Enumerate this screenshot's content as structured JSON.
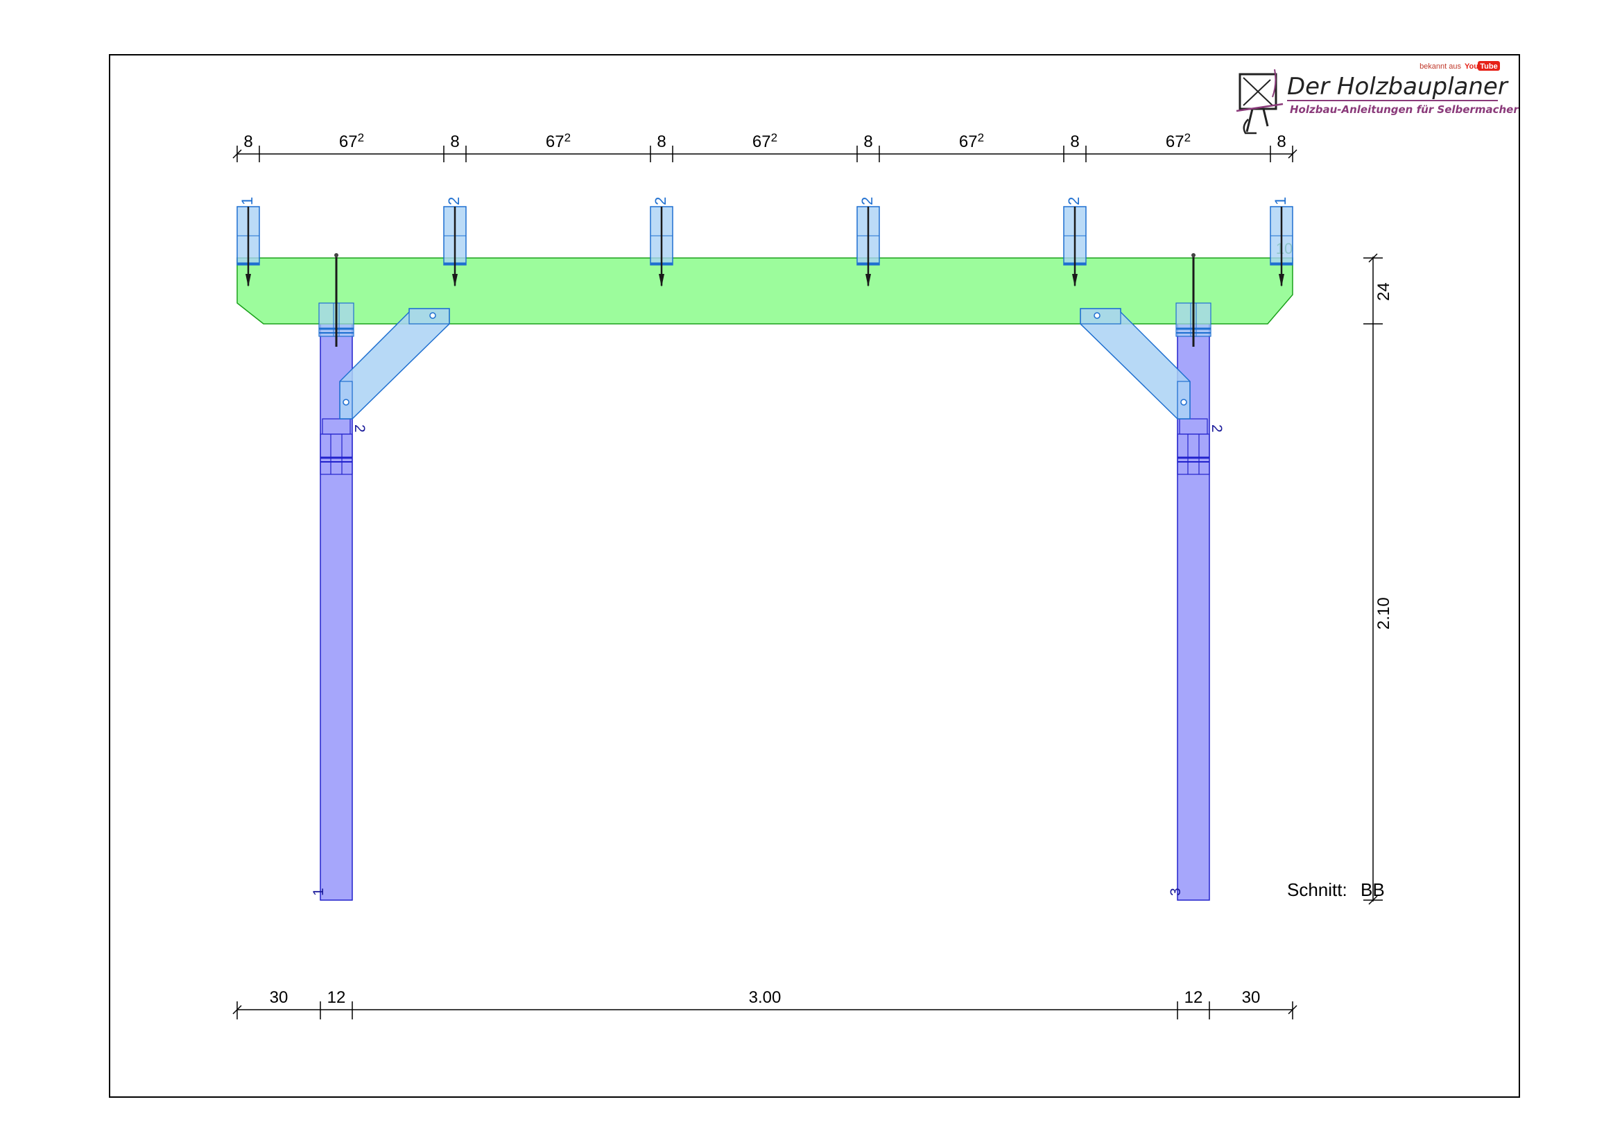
{
  "logo": {
    "known_from": "bekannt aus",
    "youtube_you": "You",
    "youtube_tube": "Tube",
    "title": "Der Holzbauplaner",
    "subtitle": "Holzbau-Anleitungen für Selbermacher"
  },
  "top_dimensions": [
    {
      "main": "8",
      "sup": ""
    },
    {
      "main": "67",
      "sup": "2"
    },
    {
      "main": "8",
      "sup": ""
    },
    {
      "main": "67",
      "sup": "2"
    },
    {
      "main": "8",
      "sup": ""
    },
    {
      "main": "67",
      "sup": "2"
    },
    {
      "main": "8",
      "sup": ""
    },
    {
      "main": "67",
      "sup": "2"
    },
    {
      "main": "8",
      "sup": ""
    },
    {
      "main": "67",
      "sup": "2"
    },
    {
      "main": "8",
      "sup": ""
    }
  ],
  "bottom_dimensions": [
    "30",
    "12",
    "3.00",
    "12",
    "30"
  ],
  "right_dimensions": [
    "24",
    "2.10"
  ],
  "rafter_labels": [
    "1",
    "2",
    "2",
    "2",
    "2",
    "1"
  ],
  "beam_label": "10",
  "post_labels": [
    "1",
    "3"
  ],
  "brace_labels": [
    "2",
    "2"
  ],
  "section": {
    "label": "Schnitt:",
    "value": "BB"
  },
  "colors": {
    "beam_fill": "#9cfc9c",
    "beam_stroke": "#1aa01a",
    "post_fill": "#a6a6fb",
    "post_stroke": "#2222cc",
    "rafter_fill": "#aad2f5",
    "rafter_stroke": "#1e6fd0",
    "frame": "#000000",
    "logo_accent": "#8a3a7a",
    "youtube_red": "#e62117"
  }
}
